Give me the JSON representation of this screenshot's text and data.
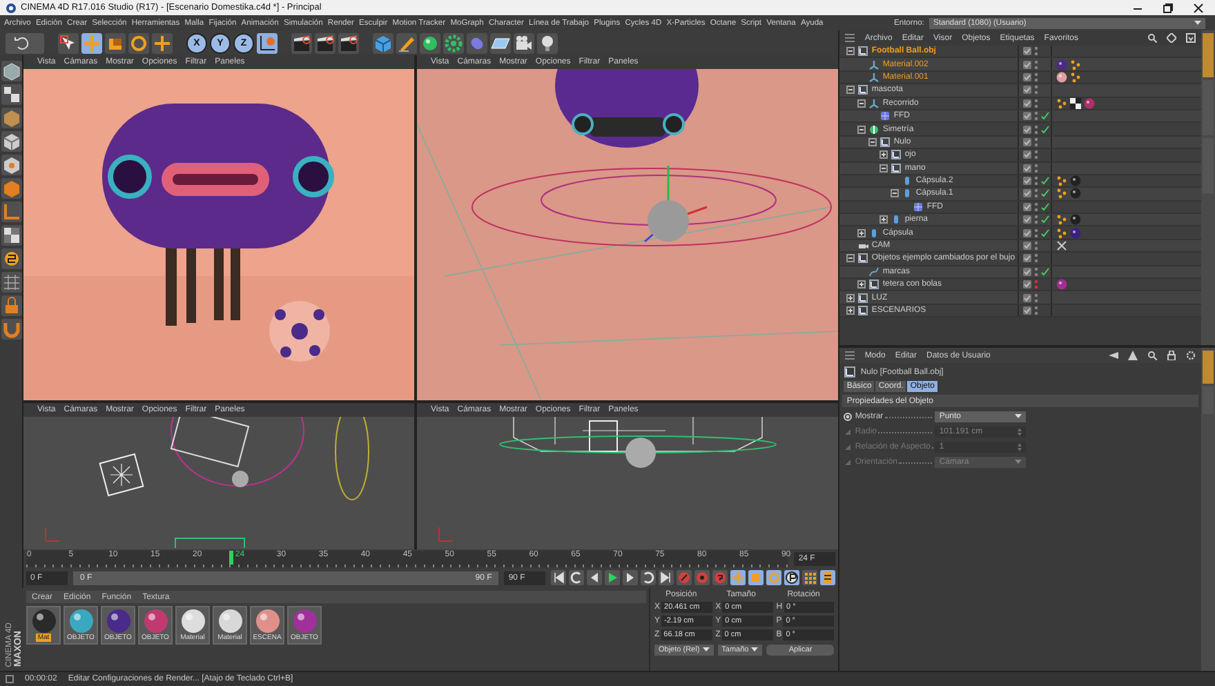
{
  "window": {
    "title": "CINEMA 4D R17.016 Studio (R17) - [Escenario Domestika.c4d *] - Principal"
  },
  "menu": [
    "Archivo",
    "Edición",
    "Crear",
    "Selección",
    "Herramientas",
    "Malla",
    "Fijación",
    "Animación",
    "Simulación",
    "Render",
    "Esculpir",
    "Motion Tracker",
    "MoGraph",
    "Character",
    "Línea de Trabajo",
    "Plugins",
    "Cycles 4D",
    "X-Particles",
    "Octane",
    "Script",
    "Ventana",
    "Ayuda"
  ],
  "layout": {
    "label": "Entorno:",
    "value": "Standard (1080) (Usuario)"
  },
  "toolbar": {
    "axis_locks": [
      {
        "label": "X",
        "selected": true
      },
      {
        "label": "Y",
        "selected": true
      },
      {
        "label": "Z",
        "selected": true
      }
    ]
  },
  "viewports": [
    {
      "kind": "render",
      "menu": [
        "Vista",
        "Cámaras",
        "Mostrar",
        "Opciones",
        "Filtrar",
        "Paneles"
      ]
    },
    {
      "kind": "perspective",
      "menu": [
        "Vista",
        "Cámaras",
        "Mostrar",
        "Opciones",
        "Filtrar",
        "Paneles"
      ]
    },
    {
      "kind": "top",
      "menu": [
        "Vista",
        "Cámaras",
        "Mostrar",
        "Opciones",
        "Filtrar",
        "Paneles"
      ]
    },
    {
      "kind": "front",
      "menu": [
        "Vista",
        "Cámaras",
        "Mostrar",
        "Opciones",
        "Filtrar",
        "Paneles"
      ]
    }
  ],
  "timeline": {
    "ruler": [
      "0",
      "5",
      "10",
      "15",
      "20",
      "30",
      "35",
      "40",
      "45",
      "50",
      "55",
      "60",
      "65",
      "70",
      "75",
      "80",
      "85",
      "90"
    ],
    "current_frame": "24",
    "level": 0.267,
    "fps": "24 F",
    "start": "0 F",
    "range_start": "0 F",
    "range_end": "90 F",
    "end": "90 F"
  },
  "object_manager": {
    "menu": [
      "Archivo",
      "Editar",
      "Visor",
      "Objetos",
      "Etiquetas",
      "Favoritos"
    ],
    "side_tabs": [
      {
        "selected": true
      },
      {
        "selected": false
      },
      {
        "selected": false
      }
    ],
    "objects": [
      {
        "name": "Football Ball.obj",
        "kind": "null",
        "expanded": true,
        "selected": true,
        "check": false,
        "hidden": false,
        "children": [
          {
            "name": "Material.002",
            "kind": "joint",
            "selected": true,
            "check": false,
            "hidden": false,
            "tags": [
              {
                "kind": "material",
                "color": "#4a2a8a"
              },
              {
                "kind": "phong"
              }
            ]
          },
          {
            "name": "Material.001",
            "kind": "joint",
            "selected": true,
            "check": false,
            "hidden": false,
            "tags": [
              {
                "kind": "material",
                "color": "#e0a0a0"
              },
              {
                "kind": "phong"
              }
            ]
          }
        ]
      },
      {
        "name": "mascota",
        "kind": "null",
        "expanded": true,
        "selected": false,
        "check": false,
        "hidden": false,
        "children": [
          {
            "name": "Recorrido",
            "kind": "joint",
            "expanded": true,
            "selected": false,
            "check": false,
            "hidden": false,
            "tags": [
              {
                "kind": "phong"
              },
              {
                "kind": "texture"
              },
              {
                "kind": "material",
                "color": "#b0306a"
              }
            ],
            "children": [
              {
                "name": "FFD",
                "kind": "ffd",
                "selected": false,
                "check": true,
                "hidden": false
              }
            ]
          },
          {
            "name": "Simetría",
            "kind": "symmetry",
            "expanded": true,
            "selected": false,
            "check": true,
            "hidden": false,
            "children": [
              {
                "name": "Nulo",
                "kind": "null",
                "expanded": true,
                "selected": false,
                "check": false,
                "hidden": false,
                "children": [
                  {
                    "name": "ojo",
                    "kind": "null",
                    "expanded": false,
                    "selected": false,
                    "check": false,
                    "hidden": false
                  },
                  {
                    "name": "mano",
                    "kind": "null",
                    "expanded": true,
                    "selected": false,
                    "check": false,
                    "hidden": false,
                    "children": [
                      {
                        "name": "Cápsula.2",
                        "kind": "capsule",
                        "selected": false,
                        "check": true,
                        "hidden": false,
                        "tags": [
                          {
                            "kind": "phong"
                          },
                          {
                            "kind": "material",
                            "color": "#222222"
                          }
                        ]
                      },
                      {
                        "name": "Cápsula.1",
                        "kind": "capsule",
                        "expanded": true,
                        "selected": false,
                        "check": true,
                        "hidden": false,
                        "tags": [
                          {
                            "kind": "phong"
                          },
                          {
                            "kind": "material",
                            "color": "#232323"
                          }
                        ],
                        "children": [
                          {
                            "name": "FFD",
                            "kind": "ffd",
                            "selected": false,
                            "check": true,
                            "hidden": false
                          }
                        ]
                      }
                    ]
                  },
                  {
                    "name": "pierna",
                    "kind": "capsule",
                    "expanded": false,
                    "selected": false,
                    "check": true,
                    "hidden": false,
                    "tags": [
                      {
                        "kind": "phong"
                      },
                      {
                        "kind": "material",
                        "color": "#202020"
                      }
                    ]
                  }
                ]
              }
            ]
          },
          {
            "name": "Cápsula",
            "kind": "capsule",
            "expanded": false,
            "selected": false,
            "check": true,
            "hidden": false,
            "tags": [
              {
                "kind": "phong"
              },
              {
                "kind": "material",
                "color": "#3a2080"
              }
            ]
          }
        ]
      },
      {
        "name": "CAM",
        "kind": "camera",
        "selected": false,
        "check": false,
        "hidden": false,
        "tags": [
          {
            "kind": "target"
          }
        ]
      },
      {
        "name": "Objetos ejemplo cambiados por el bujo",
        "kind": "null",
        "expanded": true,
        "selected": false,
        "check": false,
        "hidden": false,
        "children": [
          {
            "name": "marcas",
            "kind": "spline",
            "selected": false,
            "check": true,
            "hidden": false
          },
          {
            "name": "tetera con bolas",
            "kind": "null",
            "expanded": false,
            "selected": false,
            "check": false,
            "hidden": true,
            "tags": [
              {
                "kind": "material",
                "color": "#a03090"
              }
            ]
          }
        ]
      },
      {
        "name": "LUZ",
        "kind": "null",
        "expanded": false,
        "selected": false,
        "check": false,
        "hidden": false
      },
      {
        "name": "ESCENARIOS",
        "kind": "null",
        "expanded": false,
        "selected": false,
        "check": false,
        "hidden": false
      }
    ]
  },
  "attributes": {
    "menu": [
      "Modo",
      "Editar",
      "Datos de Usuario"
    ],
    "title": "Nulo [Football Ball.obj]",
    "side_tabs": [
      {
        "selected": true
      },
      {
        "selected": false
      }
    ],
    "tabs": [
      {
        "label": "Básico",
        "selected": false
      },
      {
        "label": "Coord.",
        "selected": false
      },
      {
        "label": "Objeto",
        "selected": true
      }
    ],
    "section": "Propiedades del Objeto",
    "fields": [
      {
        "label": "Mostrar",
        "kind": "dropdown",
        "value": "Punto",
        "disabled": false
      },
      {
        "label": "Radio",
        "kind": "number",
        "value": "101.191 cm",
        "disabled": true
      },
      {
        "label": "Relación de Aspecto",
        "kind": "number",
        "value": "1",
        "disabled": true
      },
      {
        "label": "Orientación",
        "kind": "dropdown",
        "value": "Cámara",
        "disabled": true
      }
    ]
  },
  "material_manager": {
    "logo": {
      "brand": "MAXON",
      "product": "CINEMA 4D"
    },
    "menu": [
      "Crear",
      "Edición",
      "Función",
      "Textura"
    ],
    "materials": [
      {
        "label": "Mat",
        "color": "#2a2a2a",
        "selected": true
      },
      {
        "label": "OBJETO",
        "color": "#3aa8c0",
        "selected": false
      },
      {
        "label": "OBJETO",
        "color": "#4a2a8a",
        "selected": false
      },
      {
        "label": "OBJETO",
        "color": "#c03a70",
        "selected": false
      },
      {
        "label": "Material",
        "color": "#dddddd",
        "selected": false
      },
      {
        "label": "Material",
        "color": "#d8d8d8",
        "selected": false
      },
      {
        "label": "ESCENA",
        "color": "#e0908a",
        "selected": false
      },
      {
        "label": "OBJETO",
        "color": "#a0309a",
        "selected": false
      }
    ]
  },
  "coordinates": {
    "headers": [
      "Posición",
      "Tamaño",
      "Rotación"
    ],
    "rows": [
      [
        {
          "axis": "X",
          "value": "20.461 cm"
        },
        {
          "axis": "X",
          "value": "0 cm"
        },
        {
          "axis": "H",
          "value": "0 °"
        }
      ],
      [
        {
          "axis": "Y",
          "value": "-2.19 cm"
        },
        {
          "axis": "Y",
          "value": "0 cm"
        },
        {
          "axis": "P",
          "value": "0 °"
        }
      ],
      [
        {
          "axis": "Z",
          "value": "66.18 cm"
        },
        {
          "axis": "Z",
          "value": "0 cm"
        },
        {
          "axis": "B",
          "value": "0 °"
        }
      ]
    ],
    "mode": "Objeto (Rel)",
    "size_mode": "Tamaño",
    "apply": "Aplicar"
  },
  "status_bar": {
    "time": "00:00:02",
    "message": "Editar Configuraciones de Render... [Atajo de Teclado Ctrl+B]"
  }
}
